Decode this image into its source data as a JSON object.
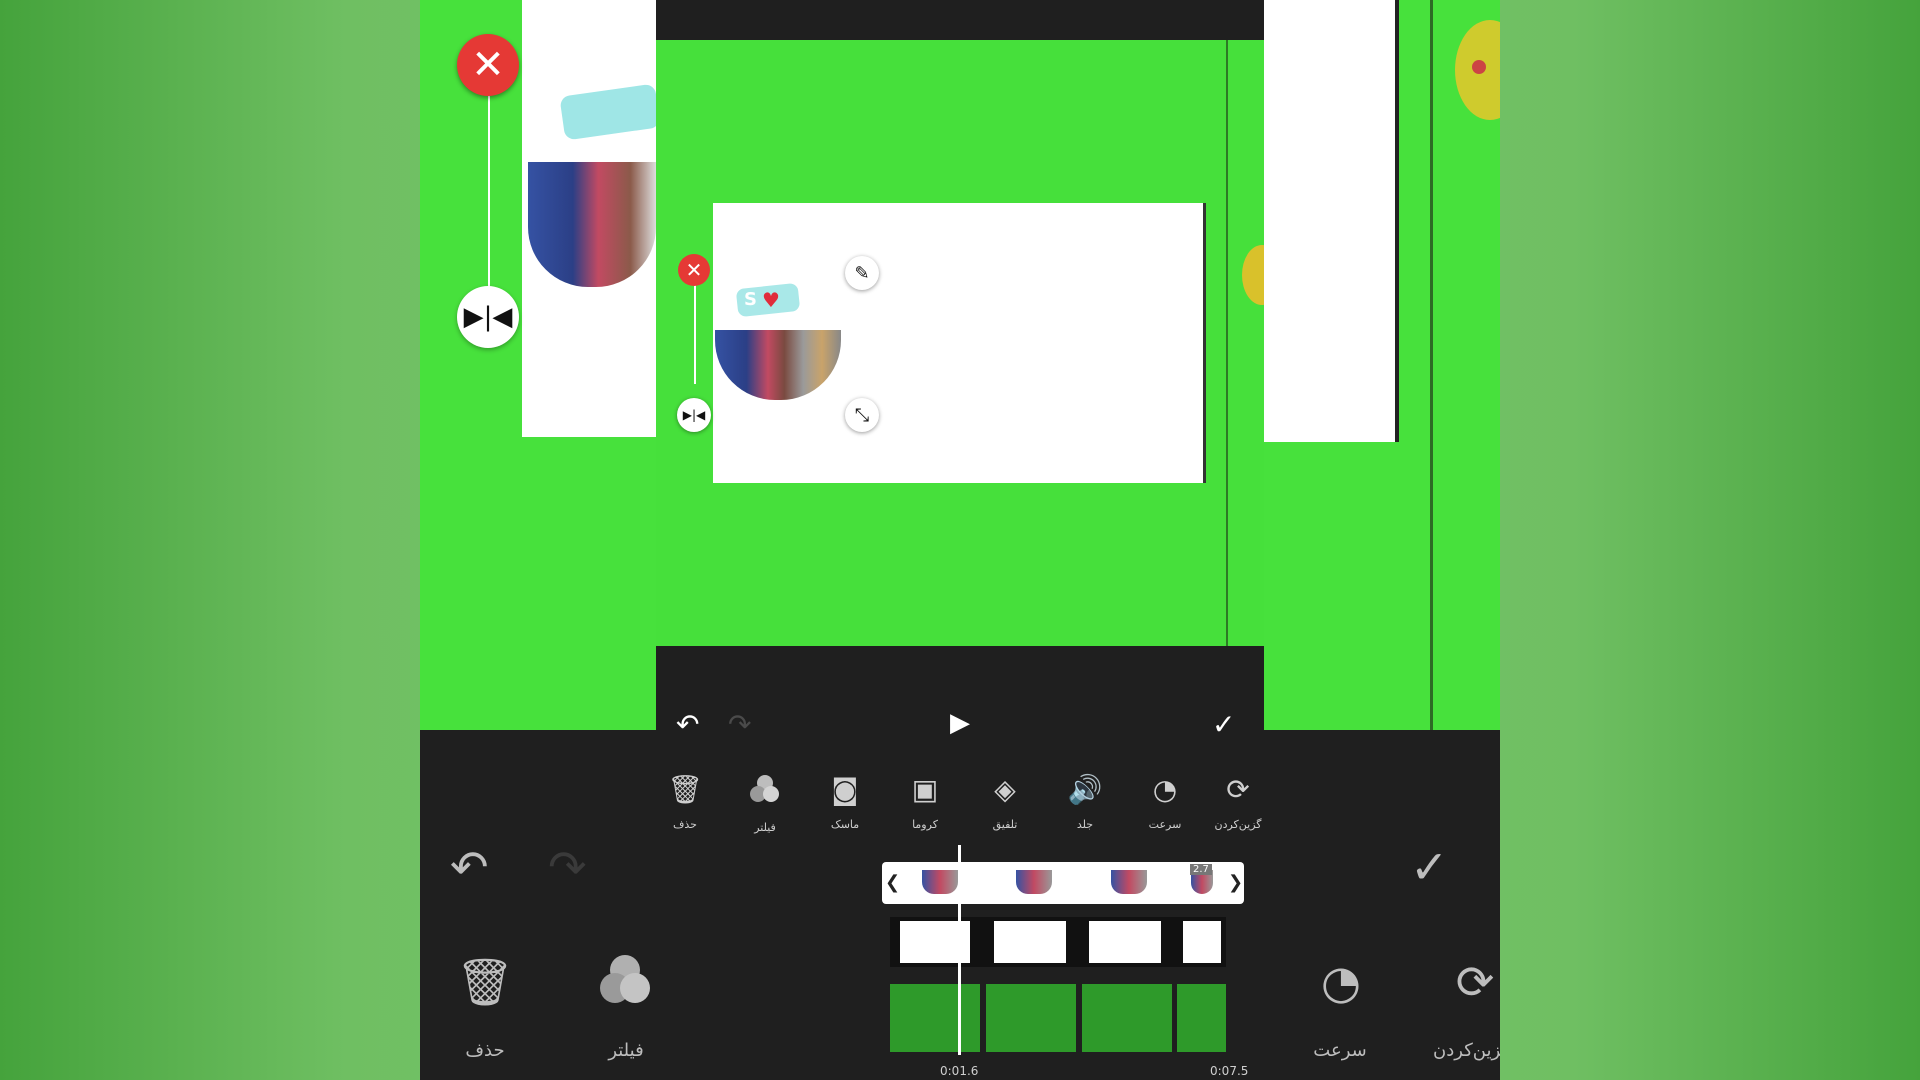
{
  "toolbar": {
    "tools": [
      {
        "icon": "trash-icon",
        "label": "حذف"
      },
      {
        "icon": "filter-icon",
        "label": "فیلتر"
      },
      {
        "icon": "mask-icon",
        "label": "ماسک"
      },
      {
        "icon": "chroma-icon",
        "label": "کروما"
      },
      {
        "icon": "blend-icon",
        "label": "تلفیق"
      },
      {
        "icon": "volume-icon",
        "label": "جلد"
      },
      {
        "icon": "speed-icon",
        "label": "سرعت"
      },
      {
        "icon": "replace-icon",
        "label": "گزین‌کردن"
      }
    ]
  },
  "background_toolbar": {
    "left_labels": [
      "حذف",
      "فیلتر"
    ],
    "right_labels": [
      "سرعت",
      "گزین‌کردن"
    ]
  },
  "timeline": {
    "current_time": "0:01.6",
    "total_time": "0:07.5",
    "clip_badge": "2.7"
  },
  "colors": {
    "chroma_green": "#46e03b",
    "accent_red": "#e53935",
    "panel_dark": "#1f1f1f"
  }
}
